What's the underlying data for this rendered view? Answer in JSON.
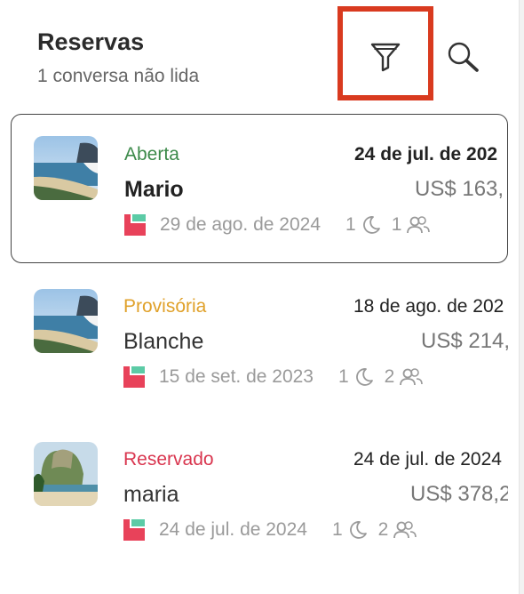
{
  "header": {
    "title": "Reservas",
    "subtitle": "1 conversa não lida"
  },
  "toolbar": {
    "filter_icon": "funnel-icon",
    "search_icon": "search-icon",
    "highlight_color": "#d93a1f"
  },
  "reservations": [
    {
      "status": "Aberta",
      "status_color": "#3c8a4a",
      "date_top": "24 de jul. de 202",
      "guest_name": "Mario",
      "price": "US$ 163,",
      "checkin_date": "29 de ago. de 2024",
      "nights": "1",
      "guests": "1",
      "selected": true
    },
    {
      "status": "Provisória",
      "status_color": "#e0a12a",
      "date_top": "18 de ago. de 202",
      "guest_name": "Blanche",
      "price": "US$ 214,",
      "checkin_date": "15 de set. de 2023",
      "nights": "1",
      "guests": "2",
      "selected": false
    },
    {
      "status": "Reservado",
      "status_color": "#d9364f",
      "date_top": "24 de jul. de 2024",
      "guest_name": "maria",
      "price": "US$ 378,2",
      "checkin_date": "24 de jul. de 2024",
      "nights": "1",
      "guests": "2",
      "selected": false
    }
  ],
  "icons": {
    "nights": "moon-icon",
    "guests": "people-icon",
    "channel": "brand-logo"
  }
}
